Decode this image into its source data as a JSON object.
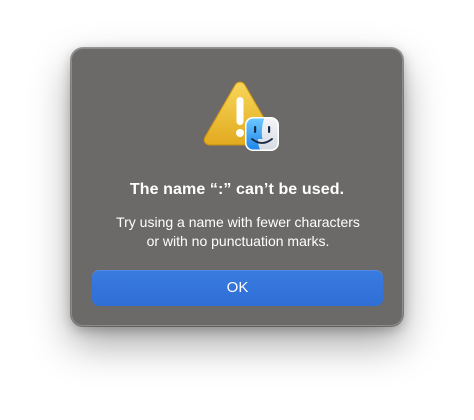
{
  "dialog": {
    "title": "The name “:” can’t be used.",
    "message_line1": "Try using a name with fewer characters",
    "message_line2": "or with no punctuation marks.",
    "ok_label": "OK",
    "icon": "caution-icon",
    "badge_icon": "finder-icon",
    "colors": {
      "dialog_background": "#6b6a69",
      "button": "#3a7be0",
      "warning_yellow": "#f2c43a",
      "finder_blue": "#3e9df5"
    }
  }
}
